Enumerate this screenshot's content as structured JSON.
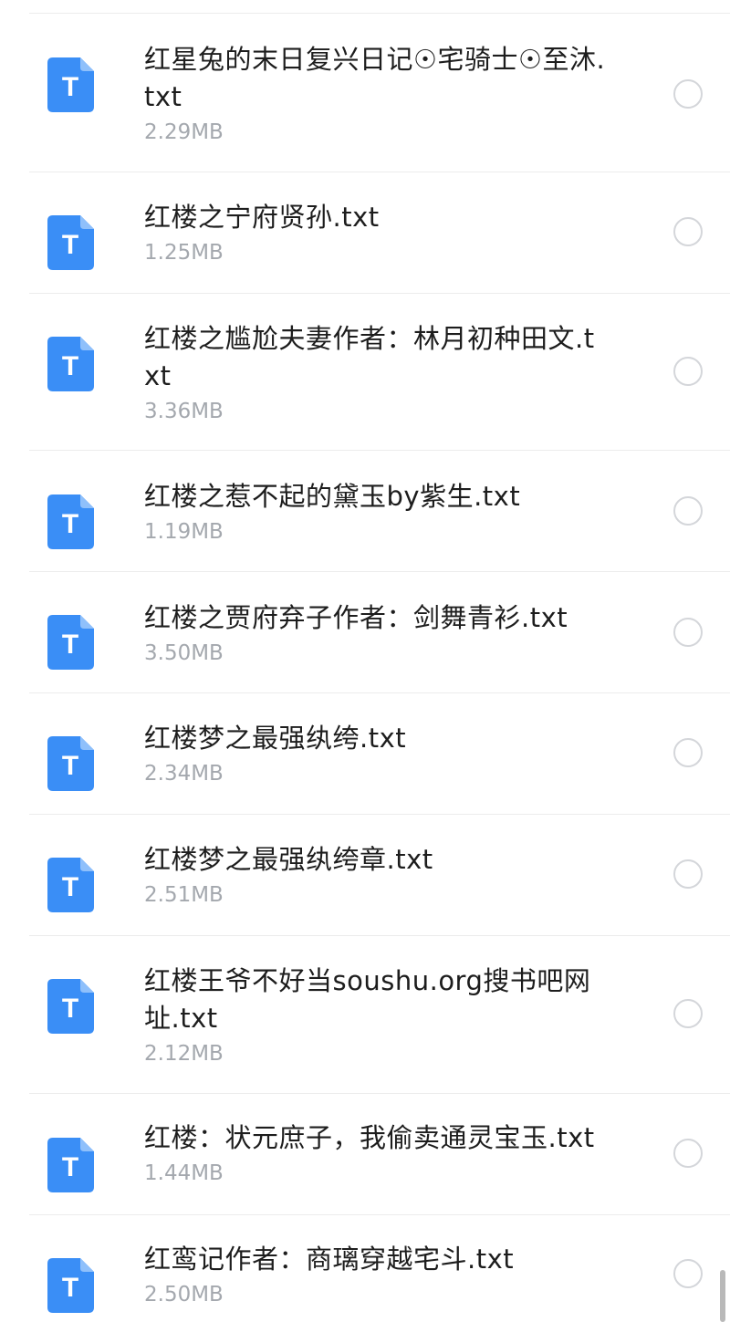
{
  "files": [
    {
      "name": "红星兔的末日复兴日记☉宅骑士☉至沐.txt",
      "size": "2.29MB"
    },
    {
      "name": "红楼之宁府贤孙.txt",
      "size": "1.25MB"
    },
    {
      "name": "红楼之尴尬夫妻作者：林月初种田文.txt",
      "size": "3.36MB"
    },
    {
      "name": "红楼之惹不起的黛玉by紫生.txt",
      "size": "1.19MB"
    },
    {
      "name": "红楼之贾府弃子作者：剑舞青衫.txt",
      "size": "3.50MB"
    },
    {
      "name": "红楼梦之最强纨绔.txt",
      "size": "2.34MB"
    },
    {
      "name": "红楼梦之最强纨绔章.txt",
      "size": "2.51MB"
    },
    {
      "name": "红楼王爷不好当soushu.org搜书吧网址.txt",
      "size": "2.12MB"
    },
    {
      "name": "红楼：状元庶子，我偷卖通灵宝玉.txt",
      "size": "1.44MB"
    },
    {
      "name": "红鸾记作者：商璃穿越宅斗.txt",
      "size": "2.50MB"
    }
  ],
  "icon": {
    "name": "txt-file-icon",
    "letter": "T",
    "color": "#3a8ef6"
  },
  "colors": {
    "title": "#1d1d1d",
    "size": "#a4a8ae",
    "radio_border": "#d4d6da",
    "divider": "#ececec"
  }
}
